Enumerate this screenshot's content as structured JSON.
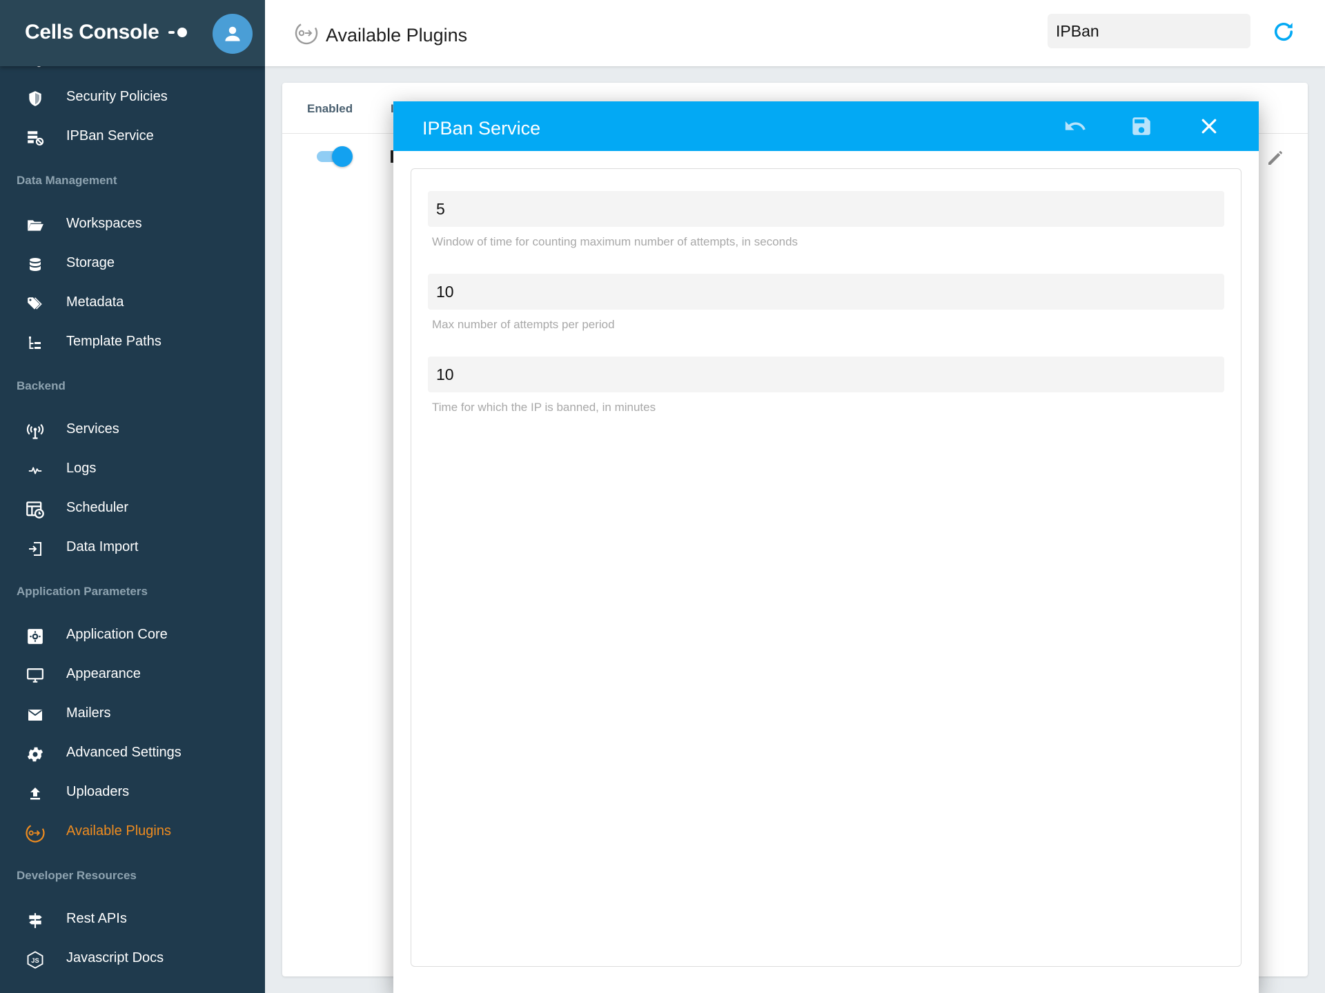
{
  "app": {
    "title": "Cells Console"
  },
  "sidebar": {
    "items": [
      {
        "type": "item",
        "label": "Authentication",
        "icon": "auth-icon",
        "clipped": true
      },
      {
        "type": "item",
        "label": "Security Policies",
        "icon": "shield-icon"
      },
      {
        "type": "item",
        "label": "IPBan Service",
        "icon": "ipban-icon"
      },
      {
        "type": "section",
        "label": "Data Management"
      },
      {
        "type": "item",
        "label": "Workspaces",
        "icon": "folder-icon"
      },
      {
        "type": "item",
        "label": "Storage",
        "icon": "database-icon"
      },
      {
        "type": "item",
        "label": "Metadata",
        "icon": "tags-icon"
      },
      {
        "type": "item",
        "label": "Template Paths",
        "icon": "tree-icon"
      },
      {
        "type": "section",
        "label": "Backend"
      },
      {
        "type": "item",
        "label": "Services",
        "icon": "antenna-icon"
      },
      {
        "type": "item",
        "label": "Logs",
        "icon": "pulse-icon"
      },
      {
        "type": "item",
        "label": "Scheduler",
        "icon": "calendar-clock-icon"
      },
      {
        "type": "item",
        "label": "Data Import",
        "icon": "import-icon"
      },
      {
        "type": "section",
        "label": "Application Parameters"
      },
      {
        "type": "item",
        "label": "Application Core",
        "icon": "core-icon"
      },
      {
        "type": "item",
        "label": "Appearance",
        "icon": "monitor-icon"
      },
      {
        "type": "item",
        "label": "Mailers",
        "icon": "mail-icon"
      },
      {
        "type": "item",
        "label": "Advanced Settings",
        "icon": "gear-icon"
      },
      {
        "type": "item",
        "label": "Uploaders",
        "icon": "upload-icon"
      },
      {
        "type": "item",
        "label": "Available Plugins",
        "icon": "plugin-icon",
        "active": true
      },
      {
        "type": "section",
        "label": "Developer Resources"
      },
      {
        "type": "item",
        "label": "Rest APIs",
        "icon": "signpost-icon"
      },
      {
        "type": "item",
        "label": "Javascript Docs",
        "icon": "js-icon"
      }
    ]
  },
  "header": {
    "title": "Available Plugins",
    "search_value": "IPBan"
  },
  "table": {
    "columns": [
      "Enabled"
    ],
    "rows": [
      {
        "enabled": true
      }
    ]
  },
  "dialog": {
    "title": "IPBan Service",
    "fields": [
      {
        "value": "5",
        "hint": "Window of time for counting maximum number of attempts, in seconds"
      },
      {
        "value": "10",
        "hint": "Max number of attempts per period"
      },
      {
        "value": "10",
        "hint": "Time for which the IP is banned, in minutes"
      }
    ]
  },
  "colors": {
    "sidebar_bg": "#1f3a4d",
    "accent": "#03a9f4",
    "active_item": "#ef8c1f",
    "avatar": "#4a9ed6"
  }
}
